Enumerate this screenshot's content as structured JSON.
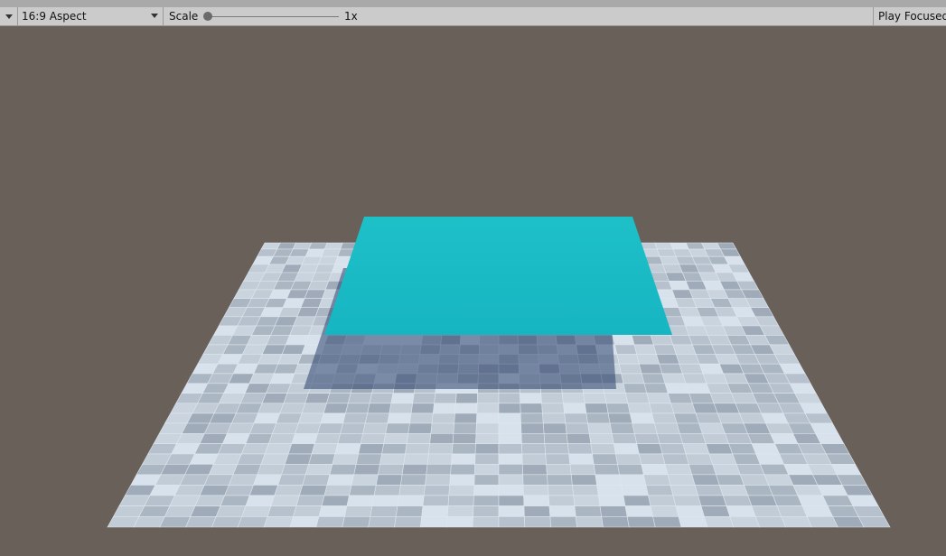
{
  "toolbar": {
    "display_dropdown_icon": "dropdown-caret-icon",
    "aspect_label": "16:9 Aspect",
    "scale_label": "Scale",
    "scale_value": "1x",
    "scale_level": 0,
    "play_focused_label": "Play Focused"
  },
  "scene": {
    "background_color": "#6a605a",
    "floor_tile_colors": [
      "#c1ccd7",
      "#aab6c2",
      "#cad4de",
      "#9fabb8",
      "#b6c1cd",
      "#d8e2ec"
    ],
    "floor_grout_color": "#dfe7ee",
    "shadow_color": "#2e4470",
    "plane_color_top": "#1ec0c8",
    "plane_color_bottom": "#16b5c2"
  }
}
